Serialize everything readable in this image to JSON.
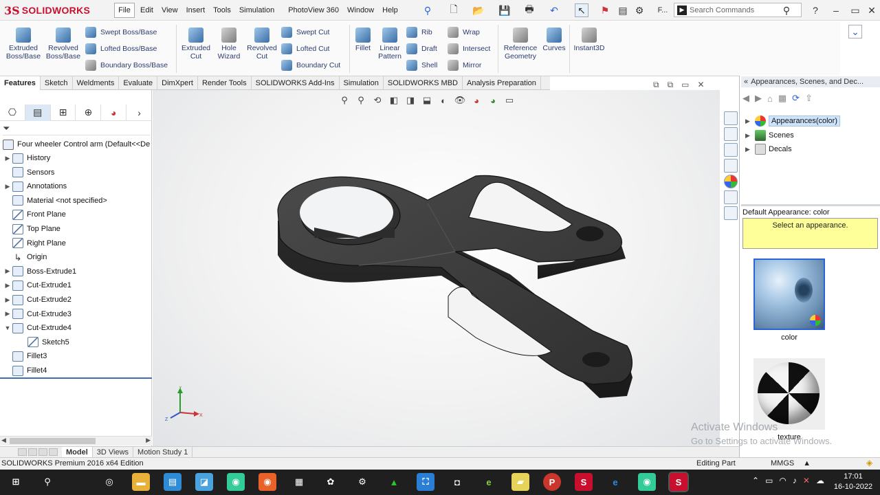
{
  "app": {
    "brand": "SOLIDWORKS",
    "search_placeholder": "Search Commands",
    "toolbar_truncated": "F..."
  },
  "menu": [
    "File",
    "Edit",
    "View",
    "Insert",
    "Tools",
    "Simulation",
    "PhotoView 360",
    "Window",
    "Help"
  ],
  "command_manager": {
    "extruded_boss": "Extruded Boss/Base",
    "revolved_boss": "Revolved Boss/Base",
    "swept_boss": "Swept Boss/Base",
    "lofted_boss": "Lofted Boss/Base",
    "boundary_boss": "Boundary Boss/Base",
    "extruded_cut": "Extruded Cut",
    "hole_wizard": "Hole Wizard",
    "revolved_cut": "Revolved Cut",
    "swept_cut": "Swept Cut",
    "lofted_cut": "Lofted Cut",
    "boundary_cut": "Boundary Cut",
    "fillet": "Fillet",
    "linear_pattern": "Linear Pattern",
    "rib": "Rib",
    "draft": "Draft",
    "shell": "Shell",
    "wrap": "Wrap",
    "intersect": "Intersect",
    "mirror": "Mirror",
    "reference_geometry": "Reference Geometry",
    "curves": "Curves",
    "instant3d": "Instant3D"
  },
  "tabs": [
    "Features",
    "Sketch",
    "Weldments",
    "Evaluate",
    "DimXpert",
    "Render Tools",
    "SOLIDWORKS Add-Ins",
    "Simulation",
    "SOLIDWORKS MBD",
    "Analysis Preparation"
  ],
  "tree": {
    "root": "Four wheeler Control arm  (Default<<De",
    "items": [
      {
        "label": "History"
      },
      {
        "label": "Sensors"
      },
      {
        "label": "Annotations"
      },
      {
        "label": "Material <not specified>"
      },
      {
        "label": "Front Plane"
      },
      {
        "label": "Top Plane"
      },
      {
        "label": "Right Plane"
      },
      {
        "label": "Origin"
      },
      {
        "label": "Boss-Extrude1"
      },
      {
        "label": "Cut-Extrude1"
      },
      {
        "label": "Cut-Extrude2"
      },
      {
        "label": "Cut-Extrude3"
      },
      {
        "label": "Cut-Extrude4"
      },
      {
        "label": "Sketch5"
      },
      {
        "label": "Fillet3"
      },
      {
        "label": "Fillet4"
      }
    ]
  },
  "bottom_tabs": [
    "Model",
    "3D Views",
    "Motion Study 1"
  ],
  "appearances_pane": {
    "title": "Appearances, Scenes, and Dec...",
    "items": [
      "Appearances(color)",
      "Scenes",
      "Decals"
    ],
    "default_label": "Default Appearance: color",
    "prompt": "Select an appearance.",
    "thumb1_label": "color",
    "thumb2_label": "texture"
  },
  "watermark": {
    "line1": "Activate Windows",
    "line2": "Go to Settings to activate Windows."
  },
  "status": {
    "edition": "SOLIDWORKS Premium 2016 x64 Edition",
    "mode": "Editing Part",
    "units": "MMGS"
  },
  "clock": {
    "time": "17:01",
    "date": "16-10-2022"
  },
  "colors": {
    "brand_red": "#c8102e",
    "selection_blue": "#2b63d6",
    "part_gray": "#3d3d3d",
    "prompt_yellow": "#ffff9a"
  }
}
